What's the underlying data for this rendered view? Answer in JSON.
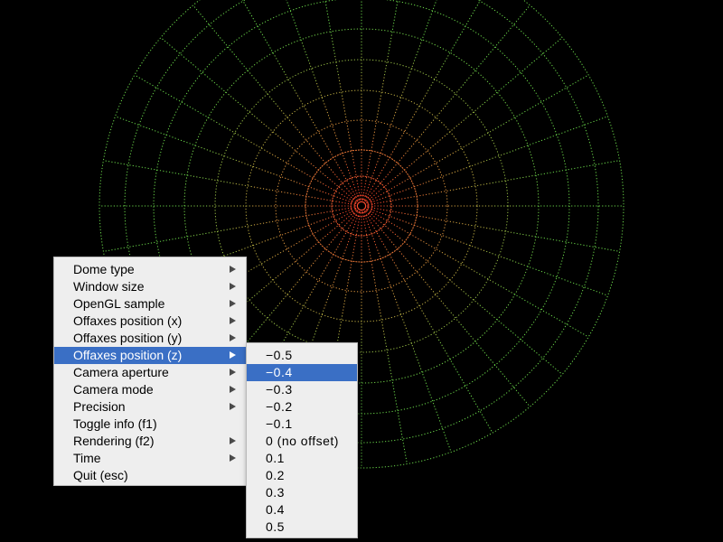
{
  "canvas": {
    "background": "#000000",
    "grid_colors": {
      "center": "#ff3a2a",
      "middle": "#e0a040",
      "outer": "#6ad84a"
    }
  },
  "main_menu": {
    "items": [
      {
        "label": "Dome type",
        "submenu": true,
        "active": false
      },
      {
        "label": "Window size",
        "submenu": true,
        "active": false
      },
      {
        "label": "OpenGL sample",
        "submenu": true,
        "active": false
      },
      {
        "label": "Offaxes position (x)",
        "submenu": true,
        "active": false
      },
      {
        "label": "Offaxes position (y)",
        "submenu": true,
        "active": false
      },
      {
        "label": "Offaxes position (z)",
        "submenu": true,
        "active": true
      },
      {
        "label": "Camera aperture",
        "submenu": true,
        "active": false
      },
      {
        "label": "Camera mode",
        "submenu": true,
        "active": false
      },
      {
        "label": "Precision",
        "submenu": true,
        "active": false
      },
      {
        "label": "Toggle info (f1)",
        "submenu": false,
        "active": false
      },
      {
        "label": "Rendering (f2)",
        "submenu": true,
        "active": false
      },
      {
        "label": "Time",
        "submenu": true,
        "active": false
      },
      {
        "label": "Quit (esc)",
        "submenu": false,
        "active": false
      }
    ]
  },
  "sub_menu": {
    "items": [
      {
        "label": "−0.5",
        "active": false
      },
      {
        "label": "−0.4",
        "active": true
      },
      {
        "label": "−0.3",
        "active": false
      },
      {
        "label": "−0.2",
        "active": false
      },
      {
        "label": "−0.1",
        "active": false
      },
      {
        "label": "0 (no offset)",
        "active": false
      },
      {
        "label": "0.1",
        "active": false
      },
      {
        "label": "0.2",
        "active": false
      },
      {
        "label": "0.3",
        "active": false
      },
      {
        "label": "0.4",
        "active": false
      },
      {
        "label": "0.5",
        "active": false
      }
    ]
  },
  "colors": {
    "menu_background": "#eeeeee",
    "highlight": "#3a6fc5",
    "highlight_text": "#ffffff"
  }
}
